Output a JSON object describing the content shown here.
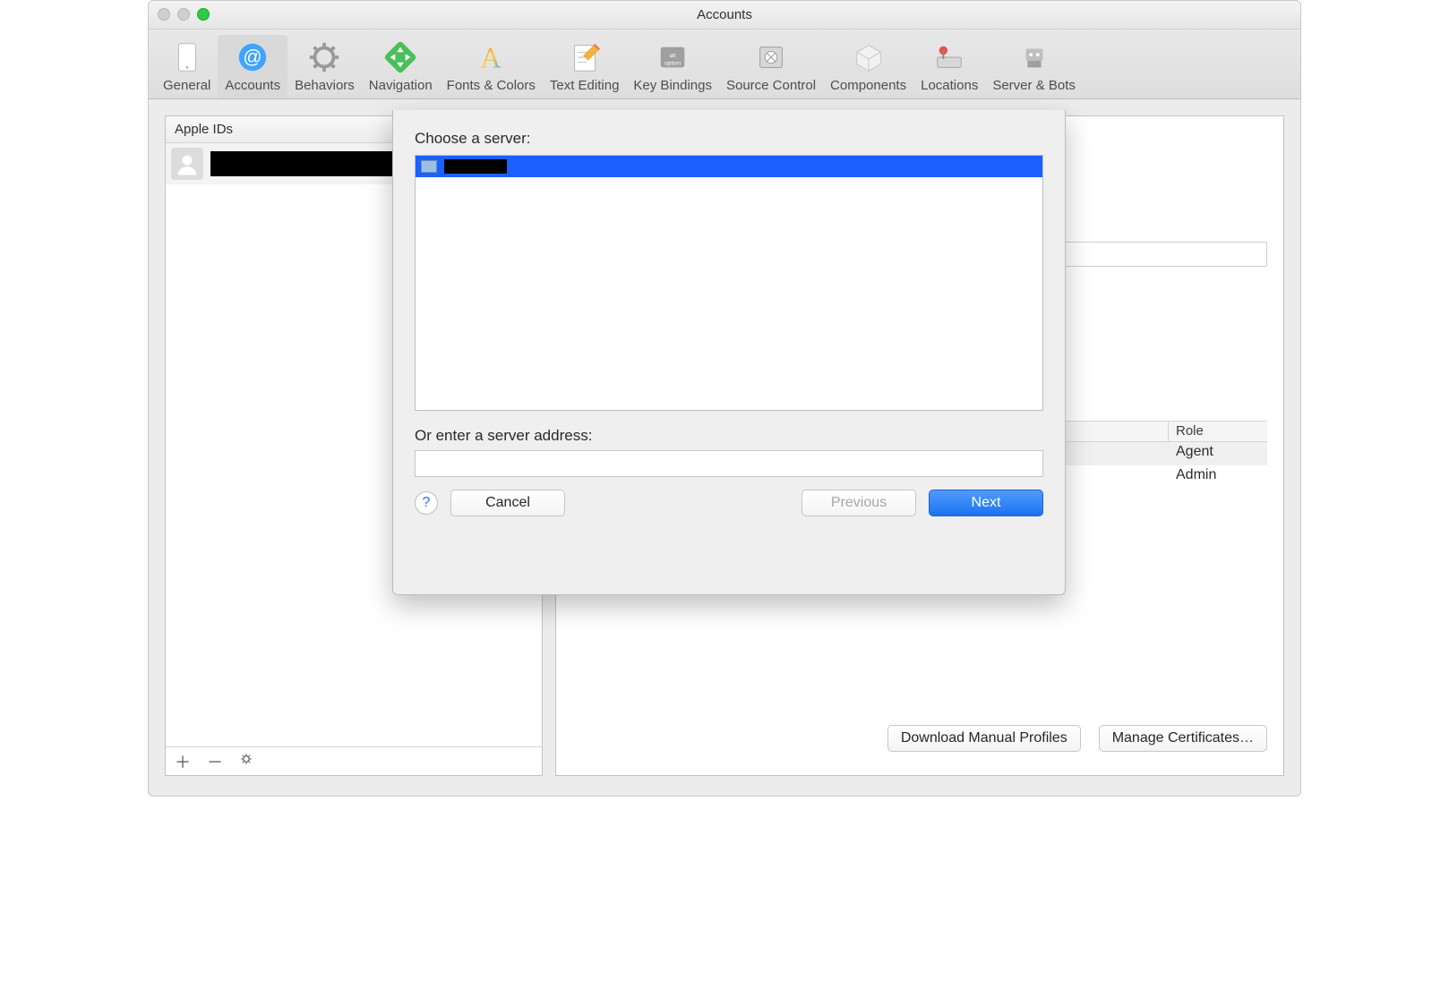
{
  "window": {
    "title": "Accounts"
  },
  "toolbar": {
    "items": [
      {
        "label": "General"
      },
      {
        "label": "Accounts"
      },
      {
        "label": "Behaviors"
      },
      {
        "label": "Navigation"
      },
      {
        "label": "Fonts & Colors"
      },
      {
        "label": "Text Editing"
      },
      {
        "label": "Key Bindings"
      },
      {
        "label": "Source Control"
      },
      {
        "label": "Components"
      },
      {
        "label": "Locations"
      },
      {
        "label": "Server & Bots"
      }
    ]
  },
  "sidebar": {
    "header": "Apple IDs",
    "account_name_redacted": ""
  },
  "content": {
    "table": {
      "role_header": "Role",
      "rows": [
        {
          "role": "Agent"
        },
        {
          "role": "Admin"
        }
      ]
    },
    "download_profiles": "Download Manual Profiles",
    "manage_certs": "Manage Certificates…"
  },
  "sheet": {
    "choose_label": "Choose a server:",
    "server_name_redacted": "",
    "address_label": "Or enter a server address:",
    "address_value": "",
    "help_glyph": "?",
    "cancel": "Cancel",
    "previous": "Previous",
    "next": "Next"
  }
}
